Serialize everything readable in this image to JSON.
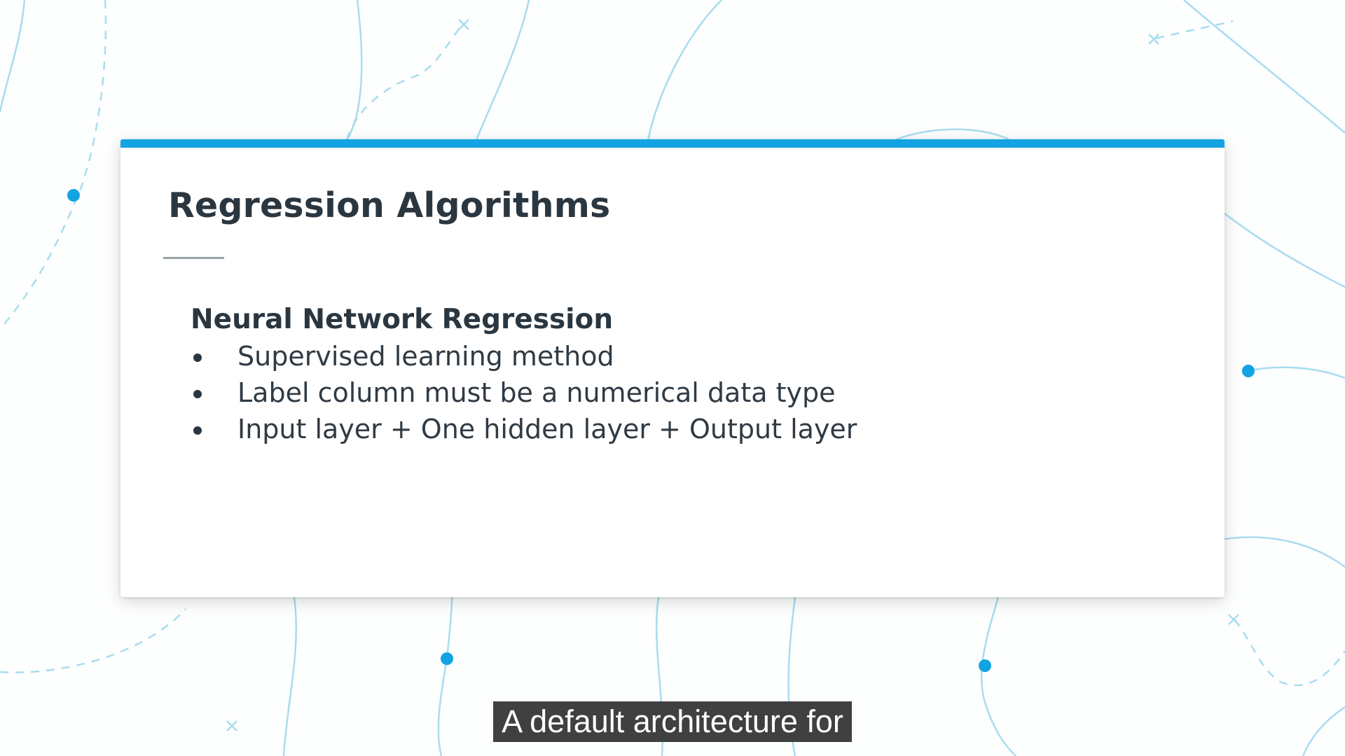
{
  "slide": {
    "title": "Regression Algorithms",
    "subheading": "Neural Network Regression",
    "bullets": [
      "Supervised learning method",
      "Label column must be a numerical data type",
      "Input layer + One hidden layer + Output layer"
    ]
  },
  "caption": {
    "text": "A default architecture for"
  },
  "colors": {
    "accent": "#12a3e2",
    "line": "#a8dcef",
    "title_text": "#2a3640",
    "caption_bg": "#303030"
  }
}
